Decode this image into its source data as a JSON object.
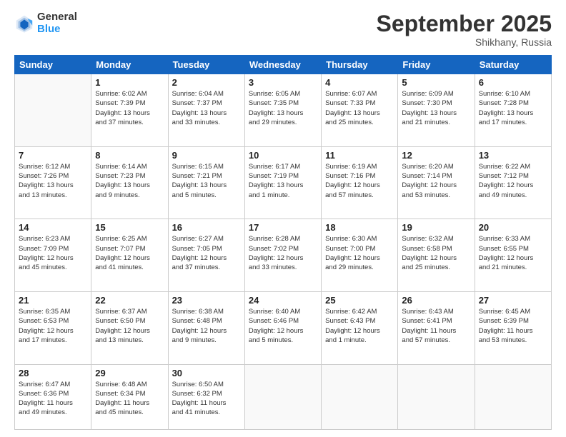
{
  "header": {
    "logo_line1": "General",
    "logo_line2": "Blue",
    "month": "September 2025",
    "location": "Shikhany, Russia"
  },
  "weekdays": [
    "Sunday",
    "Monday",
    "Tuesday",
    "Wednesday",
    "Thursday",
    "Friday",
    "Saturday"
  ],
  "weeks": [
    [
      {
        "day": "",
        "info": ""
      },
      {
        "day": "1",
        "info": "Sunrise: 6:02 AM\nSunset: 7:39 PM\nDaylight: 13 hours\nand 37 minutes."
      },
      {
        "day": "2",
        "info": "Sunrise: 6:04 AM\nSunset: 7:37 PM\nDaylight: 13 hours\nand 33 minutes."
      },
      {
        "day": "3",
        "info": "Sunrise: 6:05 AM\nSunset: 7:35 PM\nDaylight: 13 hours\nand 29 minutes."
      },
      {
        "day": "4",
        "info": "Sunrise: 6:07 AM\nSunset: 7:33 PM\nDaylight: 13 hours\nand 25 minutes."
      },
      {
        "day": "5",
        "info": "Sunrise: 6:09 AM\nSunset: 7:30 PM\nDaylight: 13 hours\nand 21 minutes."
      },
      {
        "day": "6",
        "info": "Sunrise: 6:10 AM\nSunset: 7:28 PM\nDaylight: 13 hours\nand 17 minutes."
      }
    ],
    [
      {
        "day": "7",
        "info": "Sunrise: 6:12 AM\nSunset: 7:26 PM\nDaylight: 13 hours\nand 13 minutes."
      },
      {
        "day": "8",
        "info": "Sunrise: 6:14 AM\nSunset: 7:23 PM\nDaylight: 13 hours\nand 9 minutes."
      },
      {
        "day": "9",
        "info": "Sunrise: 6:15 AM\nSunset: 7:21 PM\nDaylight: 13 hours\nand 5 minutes."
      },
      {
        "day": "10",
        "info": "Sunrise: 6:17 AM\nSunset: 7:19 PM\nDaylight: 13 hours\nand 1 minute."
      },
      {
        "day": "11",
        "info": "Sunrise: 6:19 AM\nSunset: 7:16 PM\nDaylight: 12 hours\nand 57 minutes."
      },
      {
        "day": "12",
        "info": "Sunrise: 6:20 AM\nSunset: 7:14 PM\nDaylight: 12 hours\nand 53 minutes."
      },
      {
        "day": "13",
        "info": "Sunrise: 6:22 AM\nSunset: 7:12 PM\nDaylight: 12 hours\nand 49 minutes."
      }
    ],
    [
      {
        "day": "14",
        "info": "Sunrise: 6:23 AM\nSunset: 7:09 PM\nDaylight: 12 hours\nand 45 minutes."
      },
      {
        "day": "15",
        "info": "Sunrise: 6:25 AM\nSunset: 7:07 PM\nDaylight: 12 hours\nand 41 minutes."
      },
      {
        "day": "16",
        "info": "Sunrise: 6:27 AM\nSunset: 7:05 PM\nDaylight: 12 hours\nand 37 minutes."
      },
      {
        "day": "17",
        "info": "Sunrise: 6:28 AM\nSunset: 7:02 PM\nDaylight: 12 hours\nand 33 minutes."
      },
      {
        "day": "18",
        "info": "Sunrise: 6:30 AM\nSunset: 7:00 PM\nDaylight: 12 hours\nand 29 minutes."
      },
      {
        "day": "19",
        "info": "Sunrise: 6:32 AM\nSunset: 6:58 PM\nDaylight: 12 hours\nand 25 minutes."
      },
      {
        "day": "20",
        "info": "Sunrise: 6:33 AM\nSunset: 6:55 PM\nDaylight: 12 hours\nand 21 minutes."
      }
    ],
    [
      {
        "day": "21",
        "info": "Sunrise: 6:35 AM\nSunset: 6:53 PM\nDaylight: 12 hours\nand 17 minutes."
      },
      {
        "day": "22",
        "info": "Sunrise: 6:37 AM\nSunset: 6:50 PM\nDaylight: 12 hours\nand 13 minutes."
      },
      {
        "day": "23",
        "info": "Sunrise: 6:38 AM\nSunset: 6:48 PM\nDaylight: 12 hours\nand 9 minutes."
      },
      {
        "day": "24",
        "info": "Sunrise: 6:40 AM\nSunset: 6:46 PM\nDaylight: 12 hours\nand 5 minutes."
      },
      {
        "day": "25",
        "info": "Sunrise: 6:42 AM\nSunset: 6:43 PM\nDaylight: 12 hours\nand 1 minute."
      },
      {
        "day": "26",
        "info": "Sunrise: 6:43 AM\nSunset: 6:41 PM\nDaylight: 11 hours\nand 57 minutes."
      },
      {
        "day": "27",
        "info": "Sunrise: 6:45 AM\nSunset: 6:39 PM\nDaylight: 11 hours\nand 53 minutes."
      }
    ],
    [
      {
        "day": "28",
        "info": "Sunrise: 6:47 AM\nSunset: 6:36 PM\nDaylight: 11 hours\nand 49 minutes."
      },
      {
        "day": "29",
        "info": "Sunrise: 6:48 AM\nSunset: 6:34 PM\nDaylight: 11 hours\nand 45 minutes."
      },
      {
        "day": "30",
        "info": "Sunrise: 6:50 AM\nSunset: 6:32 PM\nDaylight: 11 hours\nand 41 minutes."
      },
      {
        "day": "",
        "info": ""
      },
      {
        "day": "",
        "info": ""
      },
      {
        "day": "",
        "info": ""
      },
      {
        "day": "",
        "info": ""
      }
    ]
  ]
}
